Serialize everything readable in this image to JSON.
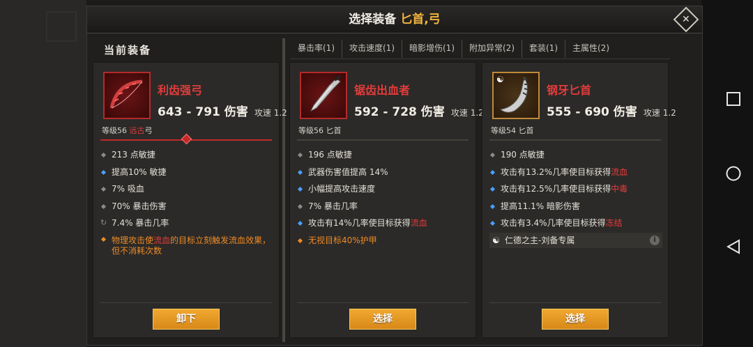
{
  "dialog": {
    "title": "选择装备 ",
    "category": "匕首,弓",
    "close_label": "✕"
  },
  "current_label": "当前装备",
  "tabs": [
    {
      "label": "暴击率(1)"
    },
    {
      "label": "攻击速度(1)"
    },
    {
      "label": "暗影增伤(1)"
    },
    {
      "label": "附加异常(2)"
    },
    {
      "label": "套装(1)"
    },
    {
      "label": "主属性(2)"
    }
  ],
  "cards": [
    {
      "name": "利齿强弓",
      "damage": "643 - 791 伤害",
      "speed": "攻速 1.2",
      "level": "等级56 ",
      "type_highlight": "远古",
      "type": "弓",
      "stats": [
        {
          "text": "213 点敏捷"
        },
        {
          "text": "提高10% 敏捷"
        },
        {
          "text": "7% 吸血"
        },
        {
          "text": "70% 暴击伤害"
        },
        {
          "text": "7.4% 暴击几率"
        }
      ],
      "special": {
        "pre": "物理攻击使",
        "hl": "流血",
        "post": "的目标立刻触发流血效果，但不消耗次数"
      },
      "button": "卸下"
    },
    {
      "name": "锯齿出血者",
      "damage": "592 - 728 伤害",
      "speed": "攻速 1.2",
      "level": "等级56 匕首",
      "stats": [
        {
          "text": "196 点敏捷"
        },
        {
          "text": "武器伤害值提高 14%"
        },
        {
          "text": "小幅提高攻击速度"
        },
        {
          "text": "7% 暴击几率"
        },
        {
          "pre": "攻击有14%几率使目标获得",
          "hl": "流血"
        },
        {
          "text": "无视目标40%护甲"
        }
      ],
      "button": "选择"
    },
    {
      "name": "钢牙匕首",
      "damage": "555 - 690 伤害",
      "speed": "攻速 1.2",
      "level": "等级54 匕首",
      "stats": [
        {
          "text": "190 点敏捷"
        },
        {
          "pre": "攻击有13.2%几率使目标获得",
          "hl": "流血"
        },
        {
          "pre": "攻击有12.5%几率使目标获得",
          "hl": "中毒"
        },
        {
          "text": "提高11.1% 暗影伤害"
        },
        {
          "pre": "攻击有3.4%几率使目标获得",
          "hl": "冻结"
        }
      ],
      "set_label": "仁德之主-刘备专属",
      "button": "选择"
    }
  ],
  "colors": {
    "rarity_red": "#e23c3c",
    "accent_gold": "#f3b53c",
    "legendary_orange": "#ee8a26",
    "button_gold": "#e09a24"
  },
  "icons": [
    "close-icon",
    "bow-icon",
    "dagger-icon",
    "curved-dagger-icon",
    "yin-yang-icon",
    "info-icon",
    "square-nav-icon",
    "circle-nav-icon",
    "back-triangle-icon"
  ]
}
